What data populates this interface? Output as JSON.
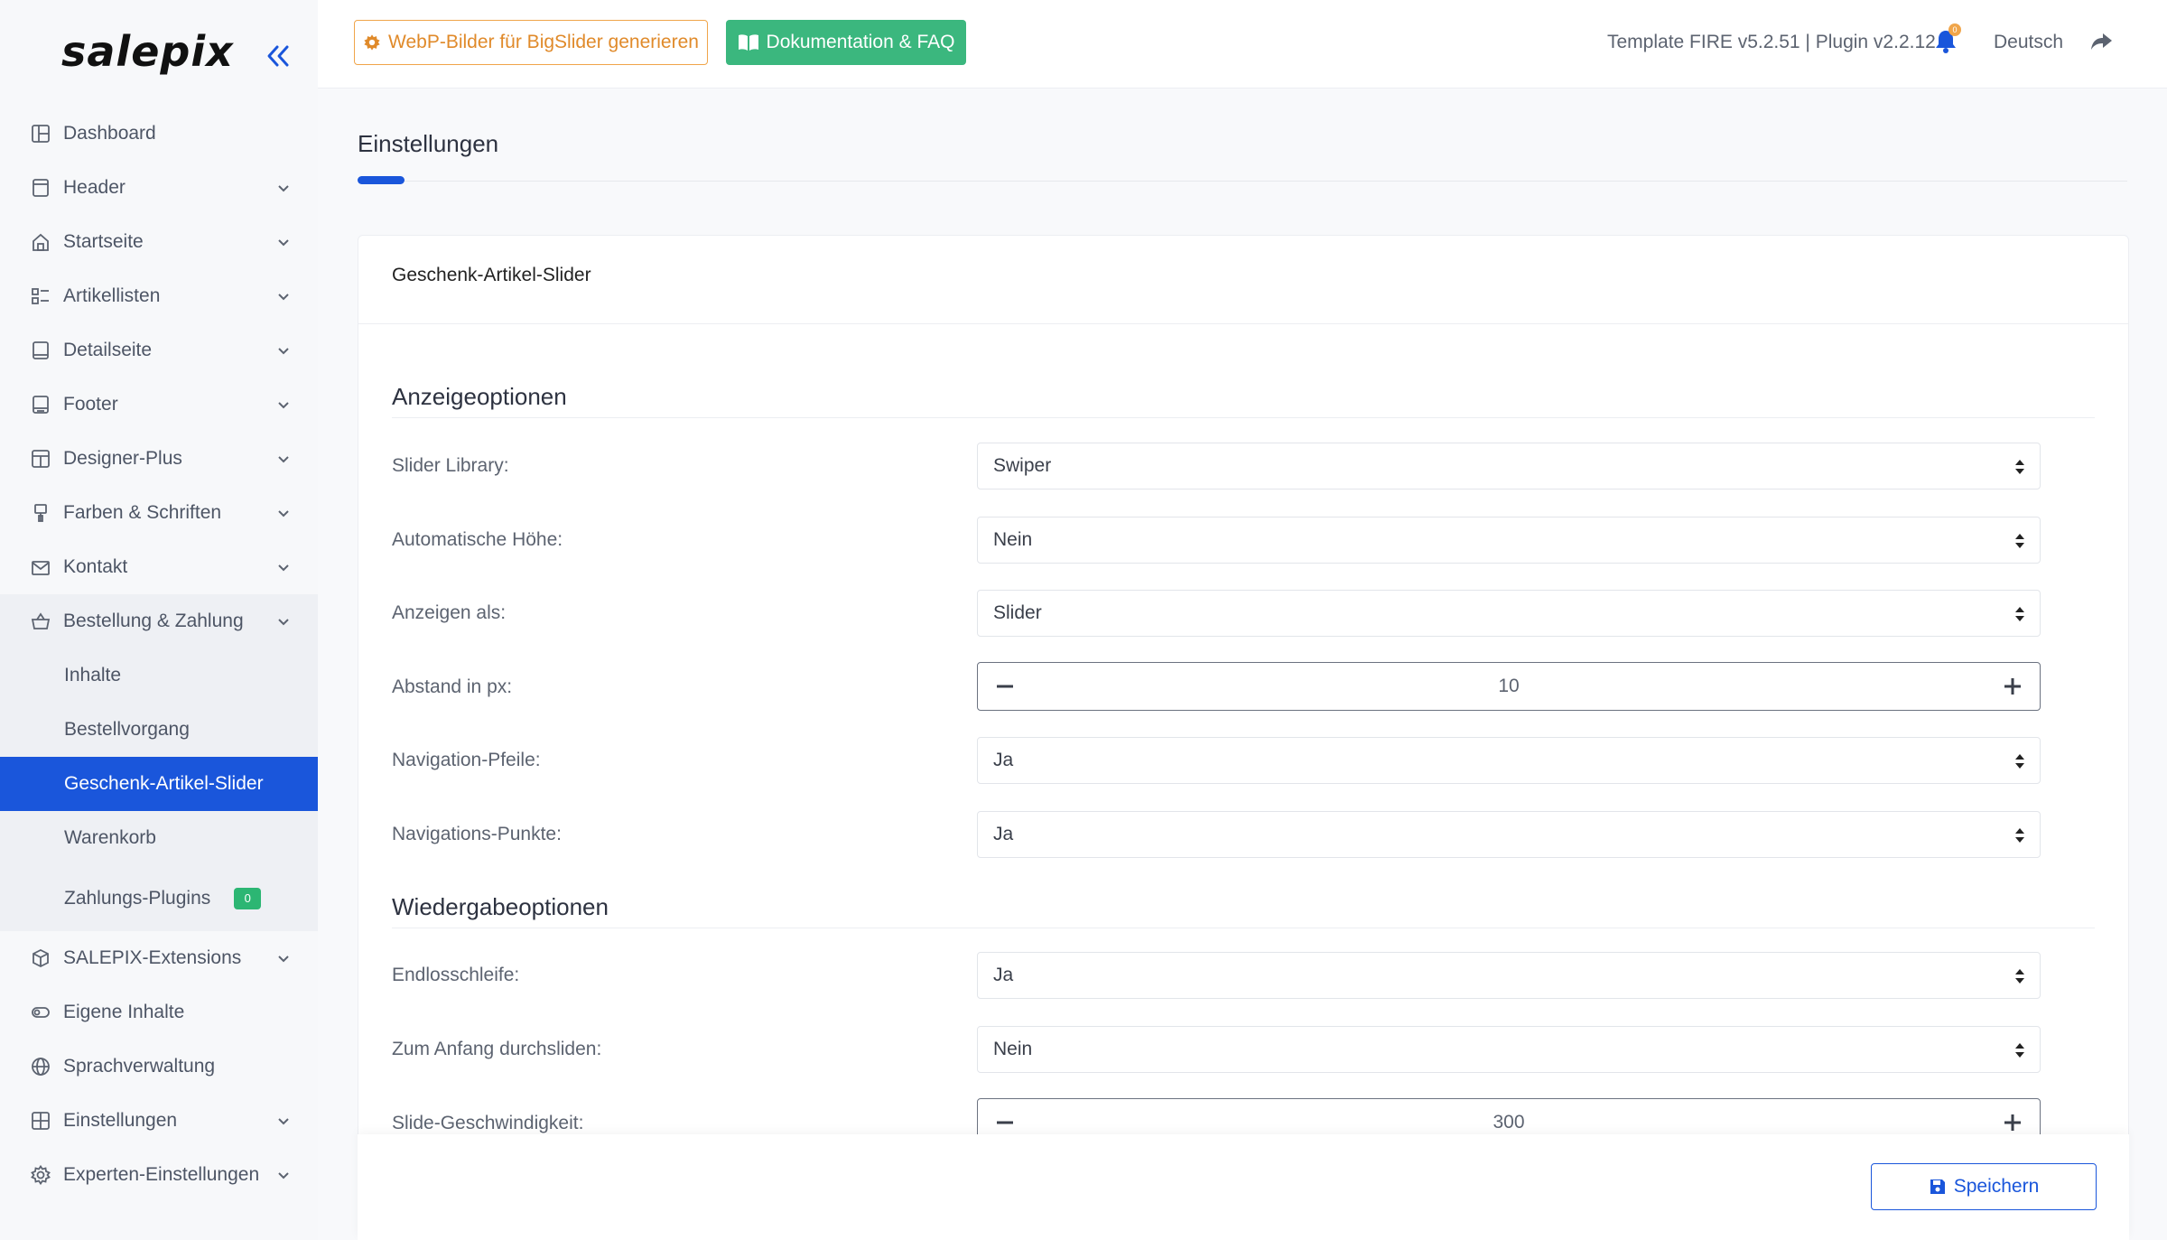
{
  "brand": {
    "logo_text": "salepix",
    "accent": "#1a56db",
    "success": "#3bb77e",
    "warning": "#f0a54a"
  },
  "sidebar": {
    "items": [
      {
        "label": "Dashboard",
        "icon": "dashboard-icon"
      },
      {
        "label": "Header",
        "icon": "header-icon"
      },
      {
        "label": "Startseite",
        "icon": "home-icon"
      },
      {
        "label": "Artikellisten",
        "icon": "list-icon"
      },
      {
        "label": "Detailseite",
        "icon": "detail-icon"
      },
      {
        "label": "Footer",
        "icon": "footer-icon"
      },
      {
        "label": "Designer-Plus",
        "icon": "designer-icon"
      },
      {
        "label": "Farben & Schriften",
        "icon": "brush-icon"
      },
      {
        "label": "Kontakt",
        "icon": "mail-icon"
      },
      {
        "label": "Bestellung & Zahlung",
        "icon": "basket-icon"
      }
    ],
    "sub_items": [
      {
        "label": "Inhalte"
      },
      {
        "label": "Bestellvorgang"
      },
      {
        "label": "Geschenk-Artikel-Slider"
      },
      {
        "label": "Warenkorb"
      },
      {
        "label": "Zahlungs-Plugins",
        "badge": "0"
      }
    ],
    "items_after": [
      {
        "label": "SALEPIX-Extensions",
        "icon": "box-icon"
      },
      {
        "label": "Eigene Inhalte",
        "icon": "toggle-icon"
      },
      {
        "label": "Sprachverwaltung",
        "icon": "globe-icon"
      },
      {
        "label": "Einstellungen",
        "icon": "grid-icon"
      },
      {
        "label": "Experten-Einstellungen",
        "icon": "gear-icon"
      }
    ]
  },
  "topbar": {
    "webp_button": "WebP-Bilder für BigSlider generieren",
    "docs_button": "Dokumentation & FAQ",
    "version": "Template FIRE v5.2.51 | Plugin v2.2.12",
    "notification_count": "0",
    "language": "Deutsch"
  },
  "main": {
    "page_title": "Einstellungen",
    "card_title": "Geschenk-Artikel-Slider",
    "section1_title": "Anzeigeoptionen",
    "section2_title": "Wiedergabeoptionen",
    "fields": {
      "slider_library": {
        "label": "Slider Library:",
        "value": "Swiper"
      },
      "auto_height": {
        "label": "Automatische Höhe:",
        "value": "Nein"
      },
      "display_as": {
        "label": "Anzeigen als:",
        "value": "Slider"
      },
      "spacing": {
        "label": "Abstand in px:",
        "value": "10"
      },
      "nav_arrows": {
        "label": "Navigation-Pfeile:",
        "value": "Ja"
      },
      "nav_dots": {
        "label": "Navigations-Punkte:",
        "value": "Ja"
      },
      "loop": {
        "label": "Endlosschleife:",
        "value": "Ja"
      },
      "rewind": {
        "label": "Zum Anfang durchsliden:",
        "value": "Nein"
      },
      "speed": {
        "label": "Slide-Geschwindigkeit:",
        "value": "300"
      }
    },
    "save_button": "Speichern"
  }
}
